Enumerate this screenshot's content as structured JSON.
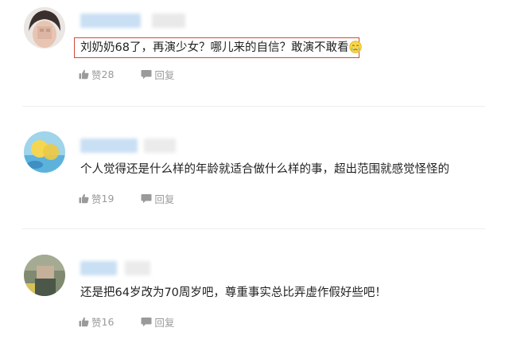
{
  "comments": [
    {
      "text": "刘奶奶68了，再演少女？哪儿来的自信？敢演不敢看",
      "emoji": "crying-face-icon",
      "likes": "28",
      "reply_label": "回复"
    },
    {
      "text": "个人觉得还是什么样的年龄就适合做什么样的事，超出范围就感觉怪怪的",
      "likes": "19",
      "reply_label": "回复"
    },
    {
      "text": "还是把64岁改为70周岁吧，尊重事实总比弄虚作假好些吧！",
      "likes": "16",
      "reply_label": "回复"
    }
  ],
  "colors": {
    "highlight_border": "#d4463c",
    "meta_text": "#9a9a9a",
    "name_blur": "#c9dff4"
  }
}
